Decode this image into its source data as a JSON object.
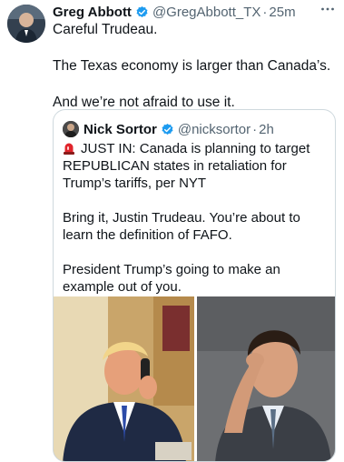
{
  "tweet": {
    "author_name": "Greg Abbott",
    "author_handle": "@GregAbbott_TX",
    "separator": "·",
    "timestamp": "25m",
    "more_icon": "more-horizontal-icon",
    "verified_color": "#1d9bf0",
    "paragraphs": [
      "Careful Trudeau.",
      "The Texas economy is larger than Canada’s.",
      "And we’re not afraid to use it."
    ]
  },
  "quoted_tweet": {
    "author_name": "Nick Sortor",
    "author_handle": "@nicksortor",
    "separator": "·",
    "timestamp": "2h",
    "siren_icon": "siren-icon",
    "paragraphs": [
      "JUST IN: Canada is planning to target REPUBLICAN states in retaliation for Trump’s tariffs, per NYT",
      "Bring it, Justin Trudeau. You’re about to learn the definition of FAFO.",
      "President Trump’s going to make an example out of you."
    ],
    "media": [
      "photo-man-on-phone-at-desk",
      "photo-man-with-hand-on-forehead"
    ]
  }
}
